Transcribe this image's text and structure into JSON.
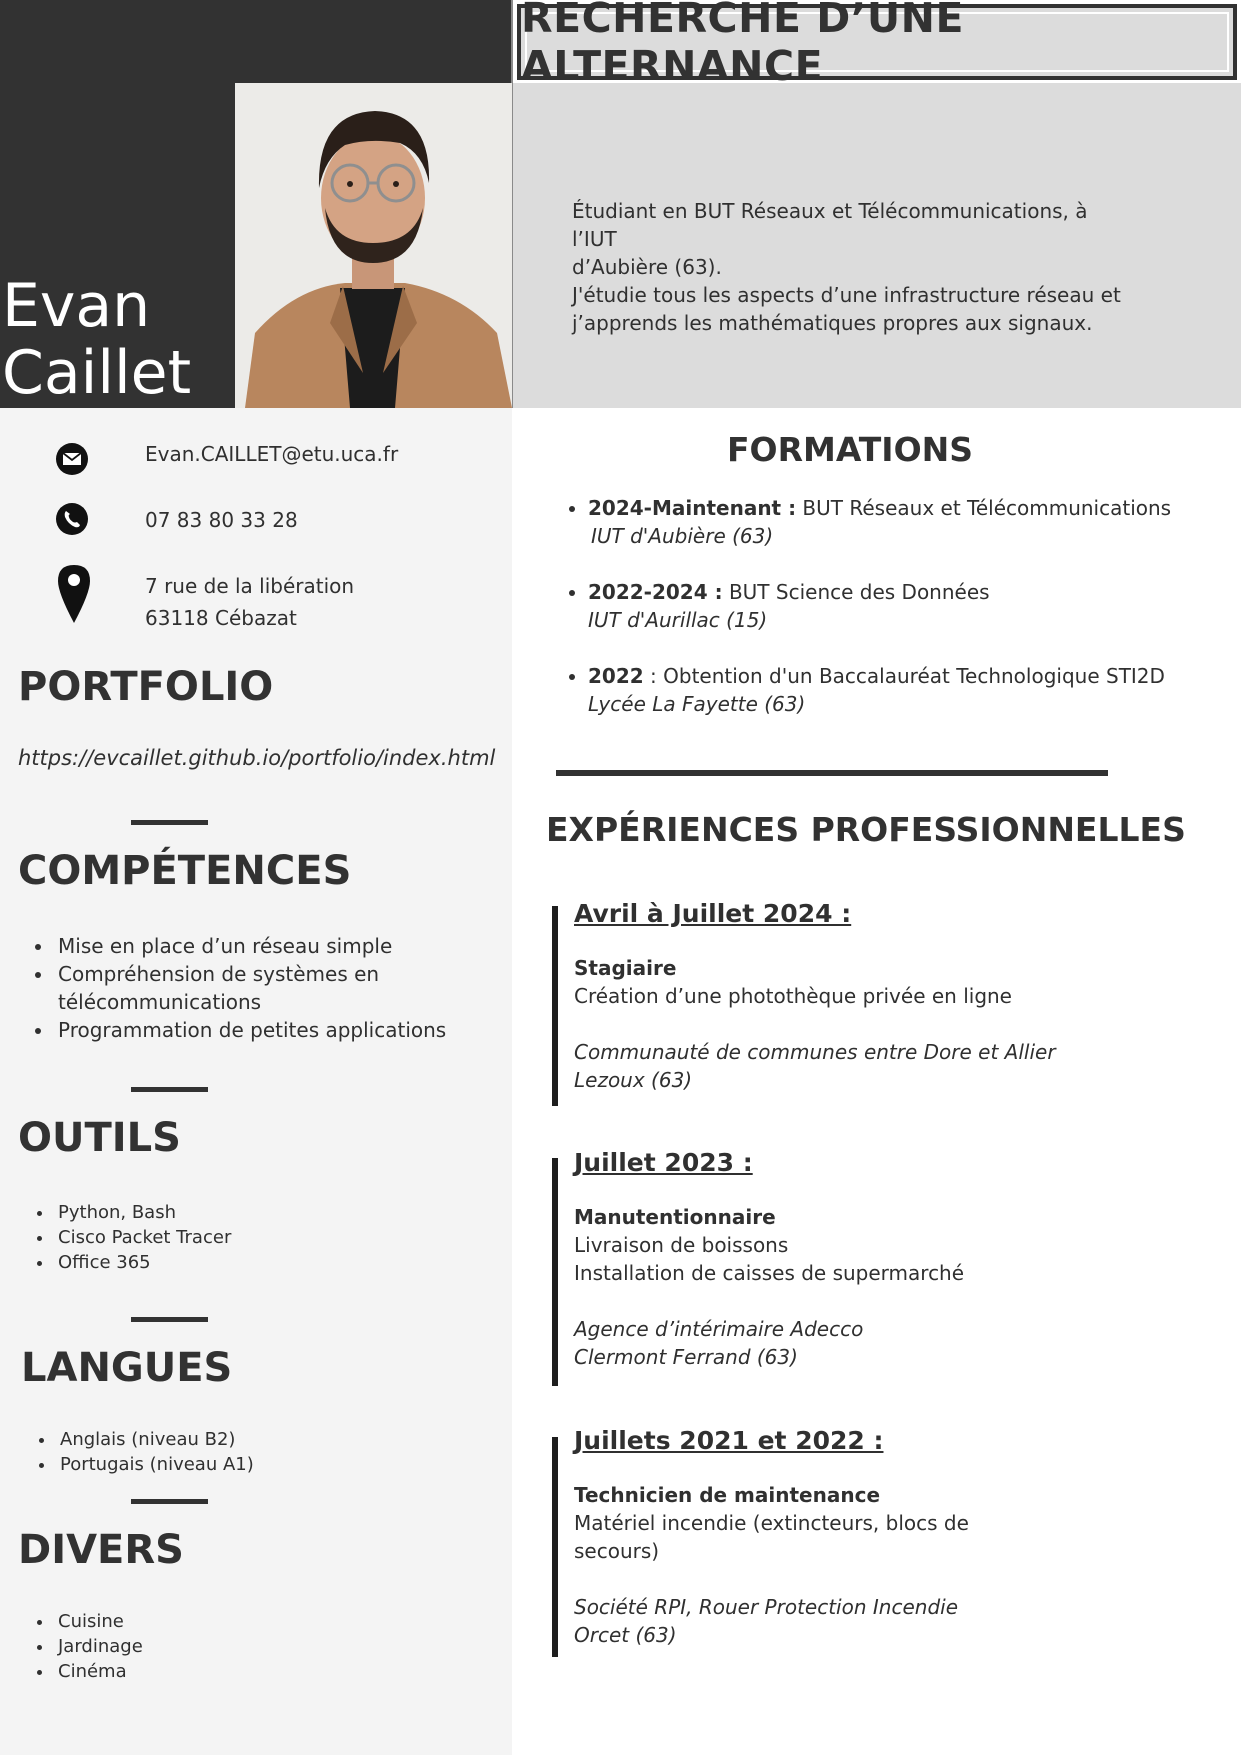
{
  "header": {
    "title": "RECHERCHE D’UNE ALTERNANCE",
    "first_name": "Evan",
    "last_name": "Caillet",
    "intro_lines": [
      "Étudiant en BUT Réseaux et Télécommunications, à l’IUT",
      "d’Aubière (63).",
      "J'étudie tous les aspects d’une infrastructure réseau et",
      "j’apprends les mathématiques propres aux signaux."
    ]
  },
  "contact": {
    "email": "Evan.CAILLET@etu.uca.fr",
    "phone": "07 83 80 33 28",
    "address_line1": "7 rue de la libération",
    "address_line2": "63118 Cébazat"
  },
  "portfolio": {
    "title": "PORTFOLIO",
    "url": "https://evcaillet.github.io/portfolio/index.html"
  },
  "competences": {
    "title": "COMPÉTENCES",
    "items": [
      "Mise en place d’un réseau simple",
      "Compréhension de systèmes en télécommunications",
      "Programmation de petites applications"
    ]
  },
  "outils": {
    "title": "OUTILS",
    "items": [
      "Python, Bash",
      "Cisco Packet Tracer",
      "Office 365"
    ]
  },
  "langues": {
    "title": "LANGUES",
    "items": [
      "Anglais (niveau B2)",
      "Portugais (niveau A1)"
    ]
  },
  "divers": {
    "title": "DIVERS",
    "items": [
      "Cuisine",
      "Jardinage",
      "Cinéma"
    ]
  },
  "formations": {
    "title": "FORMATIONS",
    "items": [
      {
        "period": "2024-Maintenant :",
        "degree": " BUT Réseaux et Télécommunications",
        "school": "IUT d'Aubière (63)"
      },
      {
        "period": "2022-2024 :",
        "degree": " BUT Science des Données",
        "school": "IUT d'Aurillac (15)"
      },
      {
        "period": "2022",
        "degree": " : Obtention d'un Baccalauréat Technologique STI2D",
        "school": "Lycée La Fayette (63)"
      }
    ]
  },
  "experiences": {
    "title": "EXPÉRIENCES PROFESSIONNELLES",
    "items": [
      {
        "date": "Avril à Juillet 2024 :",
        "role": "Stagiaire",
        "tasks": [
          "Création d’une photothèque privée en ligne"
        ],
        "company": "Communauté de communes entre Dore et Allier",
        "location": "Lezoux (63)"
      },
      {
        "date": "Juillet 2023 :",
        "role": "Manutentionnaire",
        "tasks": [
          "Livraison de boissons",
          "Installation de caisses de supermarché"
        ],
        "company": "Agence d’intérimaire Adecco",
        "location": "Clermont Ferrand (63)"
      },
      {
        "date": "Juillets 2021 et 2022 :",
        "role": "Technicien de maintenance",
        "tasks": [
          "Matériel incendie (extincteurs, blocs de",
          "secours)"
        ],
        "company": "Société RPI, Rouer Protection Incendie",
        "location": "Orcet (63)"
      }
    ]
  },
  "icons": {
    "email": "envelope-icon",
    "phone": "phone-icon",
    "address": "map-pin-icon"
  },
  "colors": {
    "dark": "#323232",
    "light_panel": "#f4f4f4",
    "banner": "#dcdcdc"
  }
}
